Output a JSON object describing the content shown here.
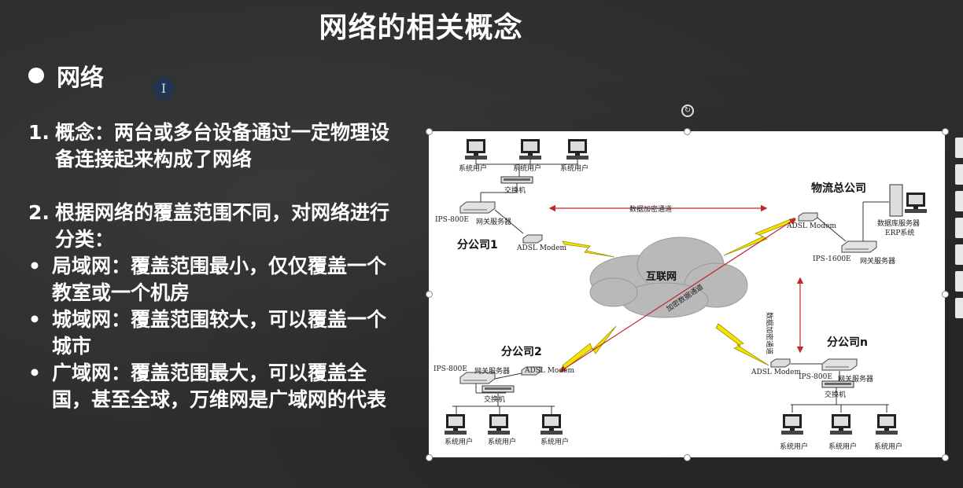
{
  "slide": {
    "title": "网络的相关概念",
    "bullet_heading": "网络",
    "items": [
      {
        "marker": "1.",
        "text": "概念：两台或多台设备通过一定物理设备连接起来构成了网络"
      },
      {
        "marker": "2.",
        "text": "根据网络的覆盖范围不同，对网络进行分类："
      }
    ],
    "sub_items": [
      {
        "marker": "•",
        "text": "局域网：覆盖范围最小，仅仅覆盖一个教室或一个机房"
      },
      {
        "marker": "•",
        "text": "城域网：覆盖范围较大，可以覆盖一个城市"
      },
      {
        "marker": "•",
        "text": "广域网：覆盖范围最大，可以覆盖全国，甚至全球，万维网是广域网的代表"
      }
    ]
  },
  "cursor_glyph": "I",
  "diagram": {
    "hq": "物流总公司",
    "branch1": "分公司1",
    "branch2": "分公司2",
    "branchn": "分公司n",
    "internet": "互联网",
    "user": "系统用户",
    "switch": "交换机",
    "gateway": "网关服务器",
    "adsl": "ADSL Modem",
    "ips800": "IPS-800E",
    "ips1600": "IPS-1600E",
    "db_server": "数据库服务器",
    "erp": "ERP系统",
    "tunnel_top": "数据加密通道",
    "tunnel_mid": "加密数据通道",
    "tunnel_right": "数据加密通道"
  },
  "colors": {
    "background": "#2e2e2e",
    "text": "#ffffff",
    "tunnel": "#c0282d",
    "lightning": "#f2e600",
    "cloud": "#b9b9b9"
  }
}
